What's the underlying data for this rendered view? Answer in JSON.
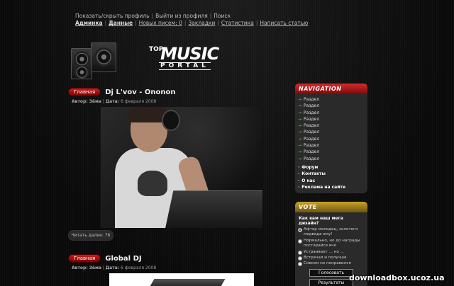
{
  "topbar": {
    "row1": [
      "Показать/скрыть профиль",
      "Выйти из профиля",
      "Поиск"
    ],
    "row2": [
      "Админка",
      "Данные",
      "Новых писем: 0",
      "Закладки",
      "Статистика",
      "Написать статью"
    ]
  },
  "logo": {
    "top": "TOP",
    "music": "MUSIC",
    "portal": "PORTAL"
  },
  "posts": [
    {
      "category": "Главная",
      "title": "Dj L'vov - Ononon",
      "author_label": "Автор:",
      "author": "Зёма",
      "date_label": "Дата:",
      "date": "6 февраля 2008",
      "read_more": "Читать далее: 76"
    },
    {
      "category": "Главная",
      "title": "Global DJ",
      "author_label": "Автор:",
      "author": "Зёма",
      "date_label": "Дата:",
      "date": "6 февраля 2008"
    }
  ],
  "navigation": {
    "header": "NAVIGATION",
    "sections": [
      "Раздел",
      "Раздел",
      "Раздел",
      "Раздел",
      "Раздел",
      "Раздел",
      "Раздел",
      "Раздел",
      "Раздел",
      "Раздел"
    ],
    "links": [
      "Форум",
      "Контакты",
      "О нас",
      "Реклама на сайте"
    ]
  },
  "vote": {
    "header": "VOTE",
    "question": "Как вам наш мега дизайн?",
    "options": [
      "Афтор молодец, золотого медведа ему!",
      "Нормально, но до награды постарайся ичо",
      "Устраивает ... но ...",
      "Встречал и получше",
      "Совсем не понравился"
    ],
    "vote_button": "Голосовать",
    "results_button": "Результаты"
  },
  "watermark": "downloadbox.ucoz.ua",
  "colors": {
    "badge": "#c92020",
    "nav_header": "#d42a2a",
    "vote_header": "#c9a32a",
    "nav_arrow": "#6bbf3a"
  }
}
